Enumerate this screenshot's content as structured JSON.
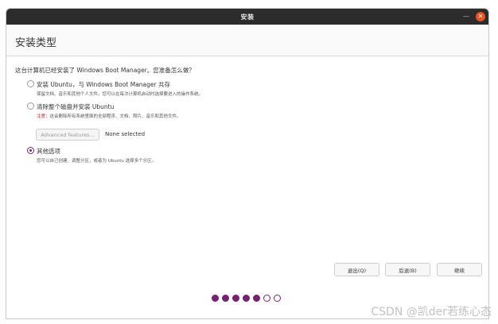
{
  "window": {
    "title": "安装"
  },
  "header": {
    "title": "安装类型"
  },
  "question": "这台计算机已经安装了 Windows Boot Manager。您准备怎么做？",
  "options": [
    {
      "label": "安装 Ubuntu，与 Windows Boot Manager 共存",
      "desc": "保留文档、音乐和其他个人文件。您可以在每次计算机启动时选择要进入的操作系统。",
      "selected": false
    },
    {
      "label": "清除整个磁盘并安装 Ubuntu",
      "warn": "注意：",
      "desc": "这会删除所有系统里面的全部程序、文档、照片、音乐和其他文件。",
      "selected": false
    },
    {
      "label": "其他选项",
      "desc": "您可以自己创建、调整分区，或者为 Ubuntu 选择多个分区。",
      "selected": true
    }
  ],
  "advanced": {
    "button_label": "Advanced features...",
    "status": "None selected"
  },
  "buttons": {
    "quit": "退出(Q)",
    "back": "后退(B)",
    "continue": "继续"
  },
  "progress": {
    "total": 7,
    "completed": 5
  },
  "watermark": "CSDN @凯der若练心态",
  "colors": {
    "accent": "#77216f",
    "close": "#e95420",
    "warning": "#c7162b"
  }
}
